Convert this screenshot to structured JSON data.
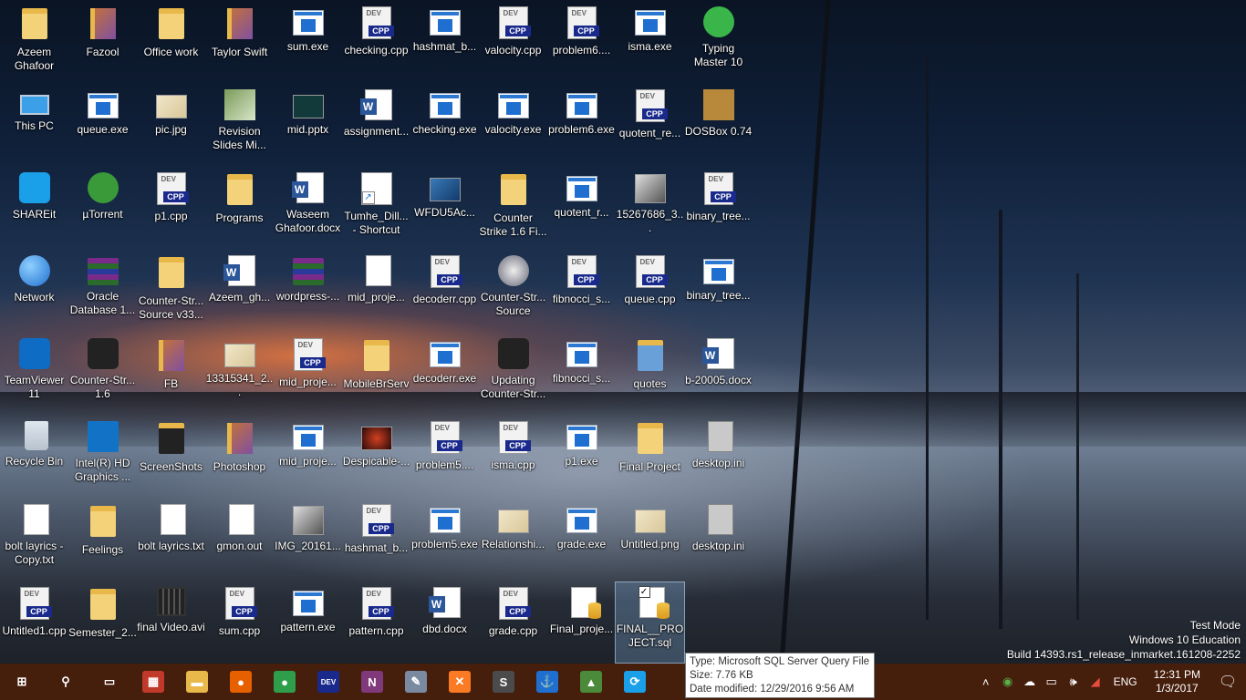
{
  "desktop": {
    "icons": [
      {
        "label": "Azeem Ghafoor",
        "kind": "folder"
      },
      {
        "label": "Fazool",
        "kind": "folder-photo"
      },
      {
        "label": "Office work",
        "kind": "folder"
      },
      {
        "label": "Taylor Swift",
        "kind": "folder-photo"
      },
      {
        "label": "sum.exe",
        "kind": "exe"
      },
      {
        "label": "checking.cpp",
        "kind": "cpp"
      },
      {
        "label": "hashmat_b...",
        "kind": "exe"
      },
      {
        "label": "valocity.cpp",
        "kind": "cpp"
      },
      {
        "label": "problem6....",
        "kind": "cpp"
      },
      {
        "label": "isma.exe",
        "kind": "exe"
      },
      {
        "label": "Typing Master 10",
        "kind": "app-green"
      },
      {
        "label": "This PC",
        "kind": "pc"
      },
      {
        "label": "queue.exe",
        "kind": "exe"
      },
      {
        "label": "pic.jpg",
        "kind": "image"
      },
      {
        "label": "Revision Slides Mi...",
        "kind": "app-slides"
      },
      {
        "label": "mid.pptx",
        "kind": "image-dark"
      },
      {
        "label": "assignment...",
        "kind": "word"
      },
      {
        "label": "checking.exe",
        "kind": "exe"
      },
      {
        "label": "valocity.exe",
        "kind": "exe"
      },
      {
        "label": "problem6.exe",
        "kind": "exe"
      },
      {
        "label": "quotent_re...",
        "kind": "cpp"
      },
      {
        "label": "DOSBox 0.74",
        "kind": "app-dosbox"
      },
      {
        "label": "SHAREit",
        "kind": "app-shareit"
      },
      {
        "label": "µTorrent",
        "kind": "app-utorrent"
      },
      {
        "label": "p1.cpp",
        "kind": "cpp"
      },
      {
        "label": "Programs",
        "kind": "folder"
      },
      {
        "label": "Waseem Ghafoor.docx",
        "kind": "word"
      },
      {
        "label": "Tumhe_Dill... - Shortcut",
        "kind": "image-shortcut"
      },
      {
        "label": "WFDU5Ac...",
        "kind": "image-blue"
      },
      {
        "label": "Counter Strike 1.6 Fi...",
        "kind": "folder"
      },
      {
        "label": "quotent_r...",
        "kind": "exe"
      },
      {
        "label": "15267686_3...",
        "kind": "image-photo"
      },
      {
        "label": "binary_tree...",
        "kind": "cpp"
      },
      {
        "label": "Network",
        "kind": "network"
      },
      {
        "label": "Oracle Database 1...",
        "kind": "rar"
      },
      {
        "label": "Counter-Str... Source v33...",
        "kind": "folder"
      },
      {
        "label": "Azeem_gh...",
        "kind": "word"
      },
      {
        "label": "wordpress-...",
        "kind": "rar"
      },
      {
        "label": "mid_proje...",
        "kind": "doc"
      },
      {
        "label": "decoderr.cpp",
        "kind": "cpp"
      },
      {
        "label": "Counter-Str... Source",
        "kind": "app-css"
      },
      {
        "label": "fibnocci_s...",
        "kind": "cpp"
      },
      {
        "label": "queue.cpp",
        "kind": "cpp"
      },
      {
        "label": "binary_tree...",
        "kind": "exe"
      },
      {
        "label": "TeamViewer 11",
        "kind": "app-teamviewer"
      },
      {
        "label": "Counter-Str... 1.6",
        "kind": "app-cs16"
      },
      {
        "label": "FB",
        "kind": "folder-photo"
      },
      {
        "label": "13315341_2...",
        "kind": "image"
      },
      {
        "label": "mid_proje...",
        "kind": "cpp"
      },
      {
        "label": "MobileBrServ",
        "kind": "folder"
      },
      {
        "label": "decoderr.exe",
        "kind": "exe"
      },
      {
        "label": "Updating Counter-Str...",
        "kind": "app-cs16"
      },
      {
        "label": "fibnocci_s...",
        "kind": "exe"
      },
      {
        "label": "quotes",
        "kind": "folder-blue"
      },
      {
        "label": "b-20005.docx",
        "kind": "word"
      },
      {
        "label": "Recycle Bin",
        "kind": "bin"
      },
      {
        "label": "Intel(R) HD Graphics ...",
        "kind": "app-intel"
      },
      {
        "label": "ScreenShots",
        "kind": "folder-dark"
      },
      {
        "label": "Photoshop",
        "kind": "folder-photo"
      },
      {
        "label": "mid_proje...",
        "kind": "exe"
      },
      {
        "label": "Despicable-...",
        "kind": "image-red"
      },
      {
        "label": "problem5....",
        "kind": "cpp"
      },
      {
        "label": "isma.cpp",
        "kind": "cpp"
      },
      {
        "label": "p1.exe",
        "kind": "exe"
      },
      {
        "label": "Final Project",
        "kind": "folder"
      },
      {
        "label": "desktop.ini",
        "kind": "ini"
      },
      {
        "label": "bolt layrics - Copy.txt",
        "kind": "doc"
      },
      {
        "label": "Feelings",
        "kind": "folder"
      },
      {
        "label": "bolt layrics.txt",
        "kind": "doc"
      },
      {
        "label": "gmon.out",
        "kind": "doc"
      },
      {
        "label": "IMG_20161...",
        "kind": "image-photo"
      },
      {
        "label": "hashmat_b...",
        "kind": "cpp"
      },
      {
        "label": "problem5.exe",
        "kind": "exe"
      },
      {
        "label": "Relationshi...",
        "kind": "image"
      },
      {
        "label": "grade.exe",
        "kind": "exe"
      },
      {
        "label": "Untitled.png",
        "kind": "image"
      },
      {
        "label": "desktop.ini",
        "kind": "ini"
      },
      {
        "label": "Untitled1.cpp",
        "kind": "cpp"
      },
      {
        "label": "Semester_2...",
        "kind": "folder"
      },
      {
        "label": "final Video.avi",
        "kind": "video"
      },
      {
        "label": "sum.cpp",
        "kind": "cpp"
      },
      {
        "label": "pattern.exe",
        "kind": "exe"
      },
      {
        "label": "pattern.cpp",
        "kind": "cpp"
      },
      {
        "label": "dbd.docx",
        "kind": "word"
      },
      {
        "label": "grade.cpp",
        "kind": "cpp"
      },
      {
        "label": "Final_proje...",
        "kind": "sql"
      },
      {
        "label": "FINAL__PROJECT.sql",
        "kind": "sql",
        "selected": true
      }
    ]
  },
  "watermark": {
    "line1": "Test Mode",
    "line2": "Windows 10 Education",
    "line3": "Build 14393.rs1_release_inmarket.161208-2252"
  },
  "tooltip": {
    "type": "Type: Microsoft SQL Server Query File",
    "size": "Size: 7.76 KB",
    "modified": "Date modified: 12/29/2016 9:56 AM"
  },
  "taskbar": {
    "apps": [
      {
        "name": "start-button",
        "glyph": "⊞",
        "color": "transparent"
      },
      {
        "name": "search-button",
        "glyph": "⚲",
        "color": "transparent"
      },
      {
        "name": "task-view-button",
        "glyph": "▭",
        "color": "transparent"
      },
      {
        "name": "winrar-app",
        "glyph": "▦",
        "color": "#c0392b"
      },
      {
        "name": "file-explorer-app",
        "glyph": "▬",
        "color": "#e8b84a"
      },
      {
        "name": "firefox-app",
        "glyph": "●",
        "color": "#e66000"
      },
      {
        "name": "chrome-app",
        "glyph": "●",
        "color": "#2e9e4a"
      },
      {
        "name": "devcpp-app",
        "glyph": "DEV",
        "color": "#1a2a8c"
      },
      {
        "name": "onenote-app",
        "glyph": "N",
        "color": "#80397b"
      },
      {
        "name": "paint-app",
        "glyph": "✎",
        "color": "#7a8aa0"
      },
      {
        "name": "xampp-app",
        "glyph": "✕",
        "color": "#fb7a24"
      },
      {
        "name": "sublime-app",
        "glyph": "S",
        "color": "#4b4b4b"
      },
      {
        "name": "anchor-app",
        "glyph": "⚓",
        "color": "#1f6fd0"
      },
      {
        "name": "chart-app",
        "glyph": "▲",
        "color": "#4a8a3a"
      },
      {
        "name": "shareit-app",
        "glyph": "⟳",
        "color": "#1aa0e8"
      }
    ],
    "tray": {
      "language": "ENG",
      "time": "12:31 PM",
      "date": "1/3/2017"
    }
  }
}
